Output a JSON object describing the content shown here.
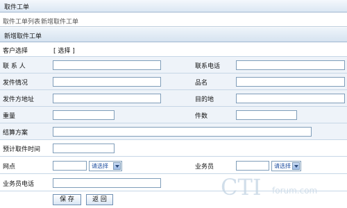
{
  "window": {
    "title": "取件工单"
  },
  "nav": {
    "list_link": "取件工单列表",
    "new_link": "新增取件工单"
  },
  "section": {
    "title": "新增取件工单"
  },
  "form": {
    "customer_label": "客户选择",
    "customer_select_link": "[ 选择 ]",
    "contact_label": "联 系 人",
    "contact_value": "",
    "phone_label": "联系电话",
    "phone_value": "",
    "status_label": "发件情况",
    "status_value": "",
    "item_name_label": "品名",
    "item_name_value": "",
    "sender_address_label": "发件方地址",
    "sender_address_value": "",
    "destination_label": "目的地",
    "destination_value": "",
    "weight_label": "重量",
    "weight_value": "",
    "pieces_label": "件数",
    "pieces_value": "",
    "settlement_label": "结算方案",
    "settlement_value": "",
    "pickup_time_label": "预计取件时间",
    "pickup_time_value": "",
    "branch_label": "网点",
    "branch_value": "",
    "branch_select": "请选择",
    "salesman_label": "业务员",
    "salesman_value": "",
    "salesman_select": "请选择",
    "salesman_phone_label": "业务员电话",
    "salesman_phone_value": ""
  },
  "buttons": {
    "save": "保 存",
    "back": "返 回"
  },
  "watermark": {
    "text": "CTI",
    "sub": "forum.com"
  },
  "colors": {
    "header_bg": "#dbe7f3",
    "row_alt_bg": "#eef3f9",
    "border": "#7f9db9",
    "select_text": "#1f4fa0"
  }
}
